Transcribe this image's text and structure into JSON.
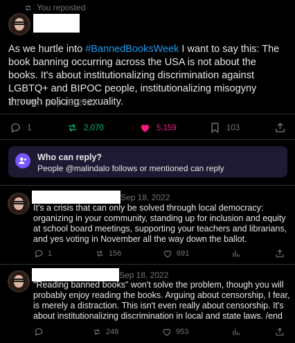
{
  "repost_label": "You reposted",
  "main_tweet": {
    "text_before": "As we hurtle into ",
    "hashtag": "#BannedBooksWeek",
    "text_after": " I want to say this: The book banning occurring across the USA is not about the books. It's about institutionalizing discrimination against LGBTQ+ and BIPOC people, institutionalizing misogyny through policing sexuality.",
    "timestamp": "1:17 PM · Sep 18, 2022",
    "replies": "1",
    "reposts": "2,070",
    "likes": "5,159",
    "bookmarks": "103"
  },
  "who_can_reply": {
    "title": "Who can reply?",
    "subtitle": "People @malindalo follows or mentioned can reply"
  },
  "reply1": {
    "date": "Sep 18, 2022",
    "text": "It's a crisis that can only be solved through local democracy: organizing in your community, standing up for inclusion and equity at school board meetings, supporting your teachers and librarians, and yes voting in November all the way down the ballot.",
    "replies": "1",
    "reposts": "156",
    "likes": "691"
  },
  "reply2": {
    "date": "Sep 18, 2022",
    "text": "\"Reading banned books\" won't solve the problem, though you will probably enjoy reading the books. Arguing about censorship, I fear, is merely a distraction. This isn't even really about censorship. It's about institutionalizing discrimination in local and state laws. /end",
    "reposts": "248",
    "likes": "953"
  },
  "colors": {
    "accent": "#1d9bf0",
    "repost_green": "#00ba7c",
    "like_pink": "#f91880",
    "reply_icon": "#7856ff"
  }
}
